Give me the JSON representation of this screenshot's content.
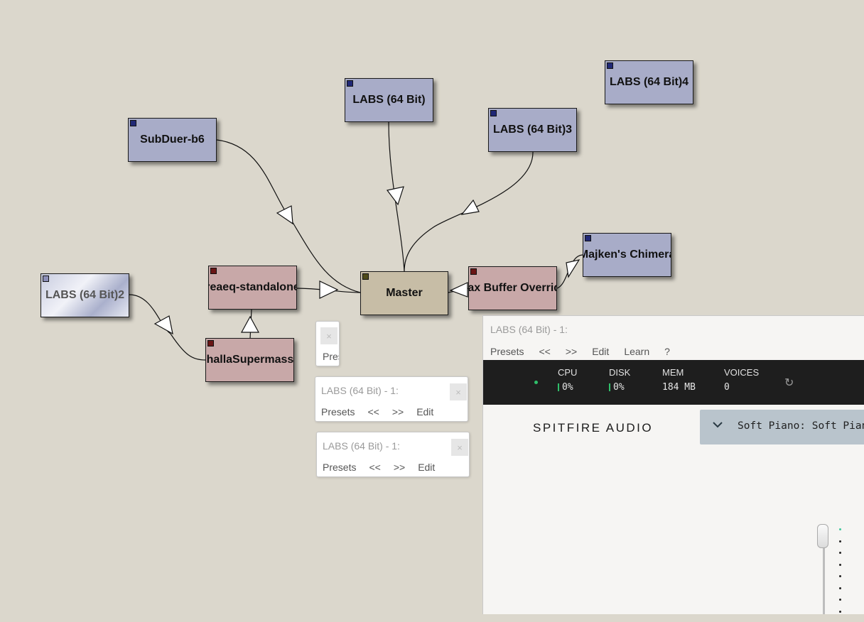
{
  "graph": {
    "nodes": {
      "subduer": "SubDuer-b6",
      "labs1": "LABS (64 Bit)",
      "labs3": "LABS (64 Bit)3",
      "labs4": "LABS (64 Bit)4",
      "majken": "Majken's Chimera",
      "labs2": "LABS (64 Bit)2",
      "reaeq": "reaeq-standalone",
      "master": "Master",
      "maxbuf": "Max Buffer Override",
      "valhalla": "ValhallaSupermassive"
    }
  },
  "plugin_windows": {
    "stub": {
      "close": "×",
      "presets": "Presets"
    },
    "mini": [
      {
        "title": "LABS (64 Bit) - 1:",
        "close": "×",
        "menu": [
          "Presets",
          "<<",
          ">>",
          "Edit"
        ]
      },
      {
        "title": "LABS (64 Bit) - 1:",
        "close": "×",
        "menu": [
          "Presets",
          "<<",
          ">>",
          "Edit"
        ]
      }
    ],
    "main": {
      "title": "LABS (64 Bit) - 1:",
      "menu": [
        "Presets",
        "<<",
        ">>",
        "Edit",
        "Learn",
        "?"
      ],
      "stats": {
        "cpu_label": "CPU",
        "cpu_value": "0%",
        "disk_label": "DISK",
        "disk_value": "0%",
        "mem_label": "MEM",
        "mem_value": "184 MB",
        "voices_label": "VOICES",
        "voices_value": "0",
        "refresh_icon": "refresh-icon"
      },
      "brand": "SPITFIRE AUDIO",
      "preset": "Soft Piano: Soft Piano",
      "chevron_icon": "chevron-down-icon",
      "accent_color": "#3fc79c"
    }
  }
}
